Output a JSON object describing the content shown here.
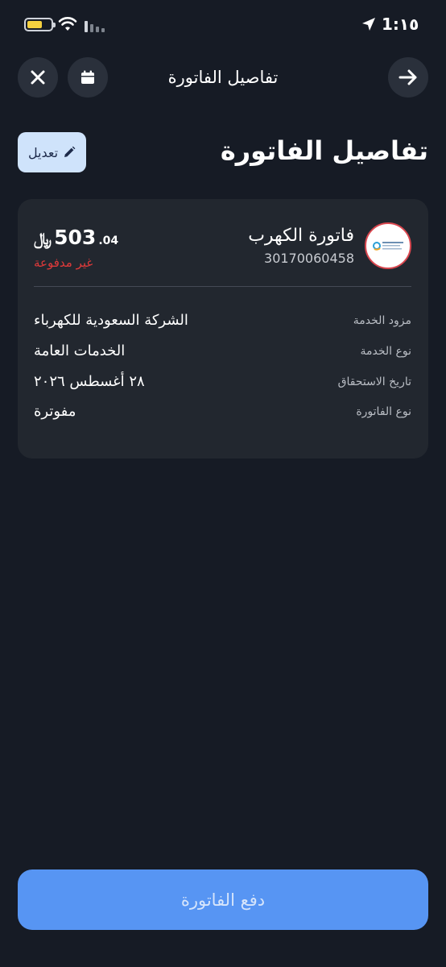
{
  "status_bar": {
    "time": "1:١٥"
  },
  "header": {
    "title": "تفاصيل الفاتورة",
    "icons": [
      "close-icon",
      "calendar-icon",
      "arrow-right-icon"
    ]
  },
  "page": {
    "title": "تفاصيل الفاتورة",
    "edit_label": "تعديل"
  },
  "bill": {
    "name": "فاتورة الكهرب",
    "number": "30170060458",
    "amount_integer": "503",
    "amount_decimal": ".04",
    "currency_symbol": "﷼",
    "status": "غير مدفوعة",
    "status_color": "#e03a3a",
    "details": [
      {
        "label": "مزود الخدمة",
        "value": "الشركة السعودية للكهرباء"
      },
      {
        "label": "نوع الخدمة",
        "value": "الخدمات العامة"
      },
      {
        "label": "تاريخ الاستحقاق",
        "value": "٢٨ أغسطس ٢٠٢٦"
      },
      {
        "label": "نوع الفاتورة",
        "value": "مفوترة"
      }
    ]
  },
  "actions": {
    "pay_label": "دفع الفاتورة"
  },
  "colors": {
    "background": "#161b25",
    "card": "#22272f",
    "accent": "#5795f3",
    "edit_button": "#cfe3fb"
  }
}
